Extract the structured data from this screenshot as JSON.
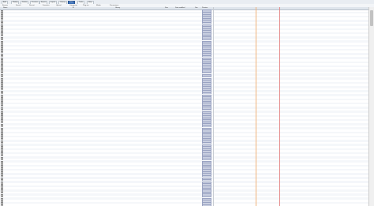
{
  "toolbar": {
    "items": [
      "Add",
      "Modify",
      "Delete",
      "Preview",
      "Export",
      "Import",
      "Library",
      "View",
      "Tools",
      "Help"
    ],
    "active_index": 7
  },
  "subtabs": [
    "Browse",
    "Search",
    "Recent",
    "Favorites",
    "Upload",
    "Categories",
    "Plug-ins",
    "Media",
    "Permissions"
  ],
  "columns": [
    "Name",
    "ID",
    "Library",
    "Size",
    "Date modified",
    "Dim",
    "Preview"
  ],
  "colors": {
    "accent": "#3b6fb6",
    "line_red": "#e58a8a",
    "line_gray": "#c8ccd2",
    "line_orange": "#f0b27a"
  },
  "rows_visible": 95
}
